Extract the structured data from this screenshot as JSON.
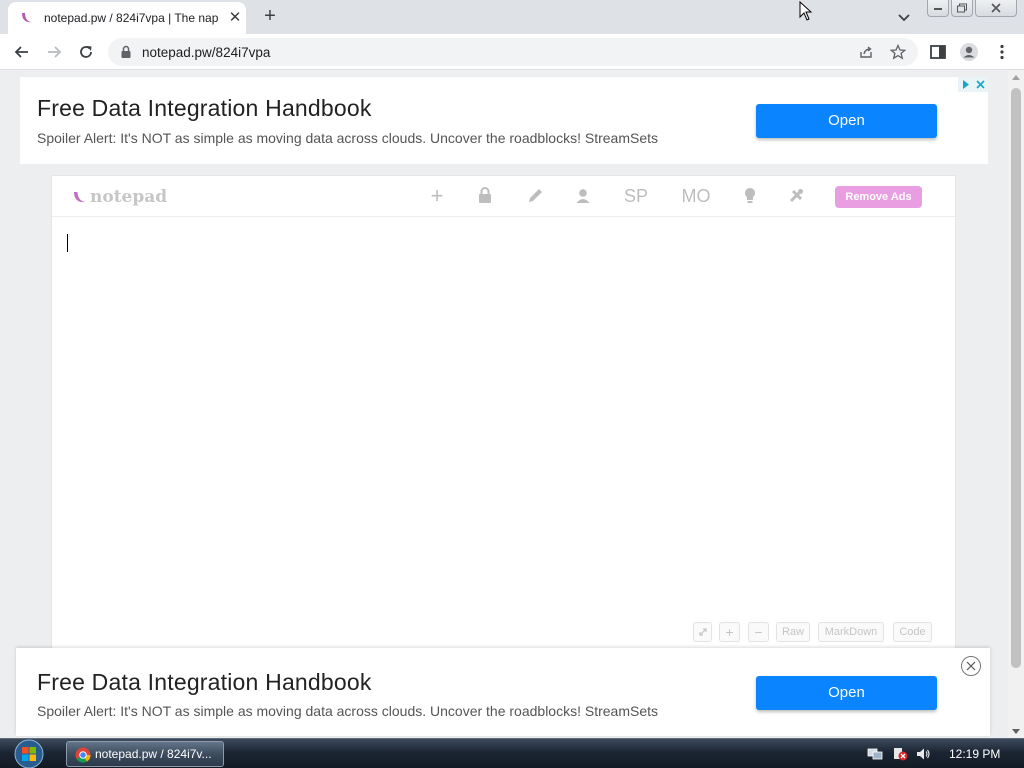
{
  "browser": {
    "tab": {
      "title": "notepad.pw / 824i7vpa | The nap"
    },
    "url": "notepad.pw/824i7vpa"
  },
  "ads": {
    "top": {
      "title": "Free Data Integration Handbook",
      "description": "Spoiler Alert: It's NOT as simple as moving data across clouds. Uncover the roadblocks! StreamSets",
      "button": "Open"
    },
    "bottom": {
      "title": "Free Data Integration Handbook",
      "description": "Spoiler Alert: It's NOT as simple as moving data across clouds. Uncover the roadblocks! StreamSets",
      "button": "Open"
    }
  },
  "notepad": {
    "logo": "notepad",
    "toolbar": {
      "add": "+",
      "sp": "SP",
      "mo": "MO",
      "remove_ads": "Remove Ads"
    },
    "editor_text": "",
    "bottom_buttons": {
      "raw": "Raw",
      "markdown": "MarkDown",
      "code": "Code"
    }
  },
  "taskbar": {
    "task_label": "notepad.pw / 824i7v...",
    "clock": "12:19 PM"
  },
  "colors": {
    "ad_button": "#0a84ff",
    "remove_ads": "#e89ee0",
    "logo_accent": "#c06fbf"
  }
}
